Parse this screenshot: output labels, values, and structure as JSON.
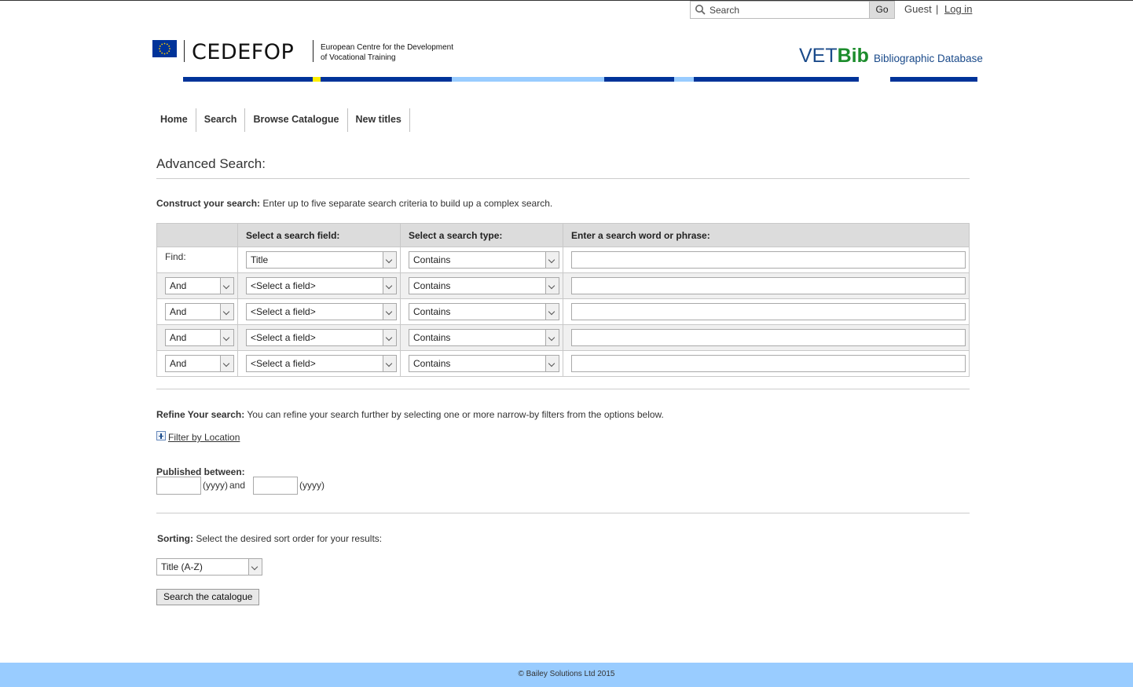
{
  "top": {
    "search_placeholder": "Search",
    "go_label": "Go",
    "guest_label": "Guest",
    "separator": "|",
    "login_label": "Log in"
  },
  "header": {
    "logo_text": "CEDEFOP",
    "logo_sub_line1": "European Centre for the Development",
    "logo_sub_line2": "of Vocational Training",
    "vet": "VET",
    "bib": "Bib",
    "vetbib_subtitle": "Bibliographic Database",
    "stripe_colors": {
      "dark": "#003399",
      "light": "#99ccff",
      "yellow": "#ffee00"
    }
  },
  "nav": {
    "items": [
      "Home",
      "Search",
      "Browse Catalogue",
      "New titles"
    ]
  },
  "main": {
    "title": "Advanced Search:",
    "construct_label": "Construct your search:",
    "construct_text": " Enter up to five separate search criteria to build up a complex search.",
    "table_headers": [
      "",
      "Select a search field:",
      "Select a search type:",
      "Enter a search word or phrase:"
    ],
    "rows": [
      {
        "operator": "Find:",
        "field": "Title",
        "type": "Contains",
        "value": ""
      },
      {
        "operator": "And",
        "field": "<Select a field>",
        "type": "Contains",
        "value": ""
      },
      {
        "operator": "And",
        "field": "<Select a field>",
        "type": "Contains",
        "value": ""
      },
      {
        "operator": "And",
        "field": "<Select a field>",
        "type": "Contains",
        "value": ""
      },
      {
        "operator": "And",
        "field": "<Select a field>",
        "type": "Contains",
        "value": ""
      }
    ],
    "refine_label": "Refine Your search:",
    "refine_text": " You can refine your search further by selecting one or more narrow-by filters from the options below.",
    "filter_location": "Filter by Location",
    "published_label": "Published between:",
    "yyyy1": "(yyyy)",
    "and_label": "and",
    "yyyy2": "(yyyy)",
    "sorting_label": "Sorting:",
    "sorting_text": " Select the desired sort order for your results:",
    "sort_value": "Title (A-Z)",
    "search_button": "Search the catalogue"
  },
  "footer": {
    "copyright": "© Bailey Solutions Ltd 2015"
  }
}
